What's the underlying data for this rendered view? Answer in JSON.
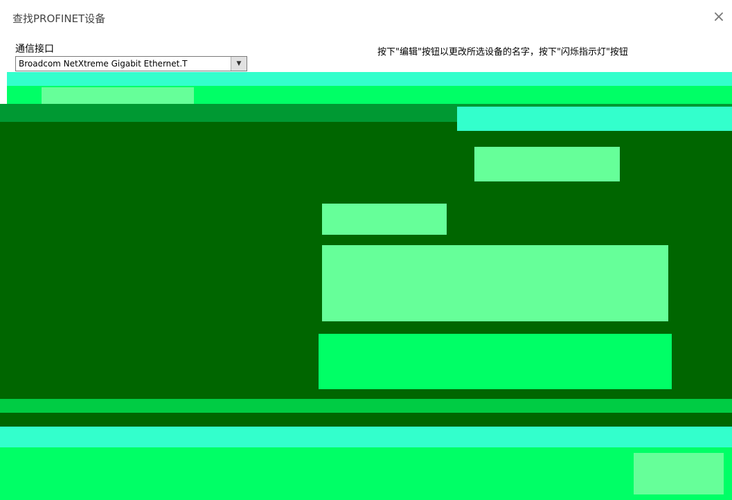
{
  "window": {
    "title": "查找PROFINET设备",
    "close_glyph": "×"
  },
  "interface": {
    "label": "通信接口",
    "value": "Broadcom NetXtreme Gigabit Ethernet.T"
  },
  "instruction": "按下\"编辑\"按钮以更改所选设备的名字，按下\"闪烁指示灯\"按钮",
  "colors": {
    "dark_green": "#006600",
    "bright_green": "#00ff66",
    "cyan": "#33ffcc",
    "light_green": "#66ff99"
  }
}
